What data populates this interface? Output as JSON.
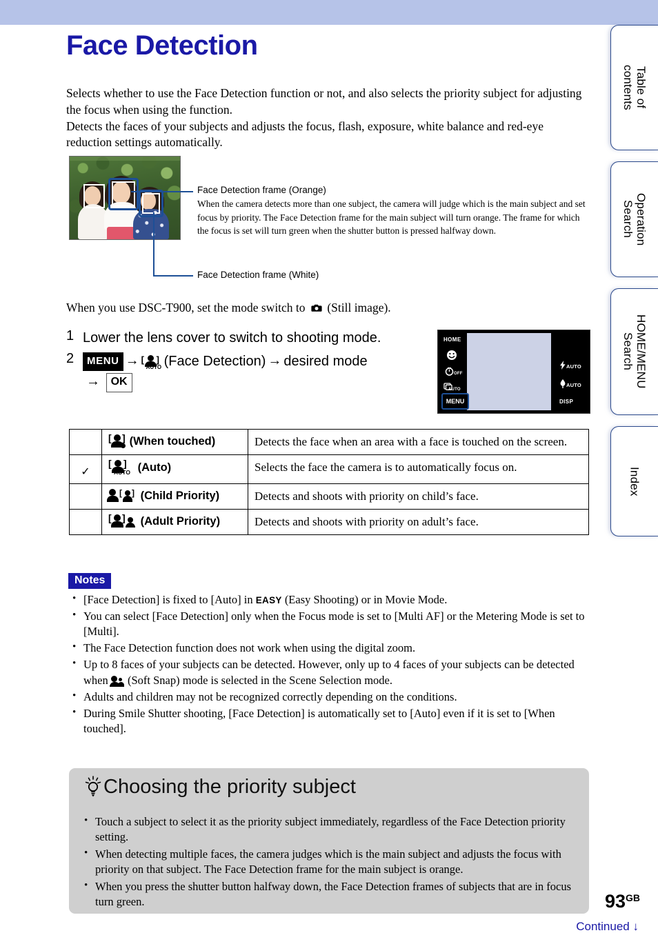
{
  "page": {
    "title": "Face Detection",
    "page_number": "93",
    "page_number_suffix": "GB",
    "continued": "Continued",
    "continued_arrow": "↓"
  },
  "sidebar": {
    "tabs": [
      {
        "label": "Table of\ncontents",
        "name": "table-of-contents"
      },
      {
        "label": "Operation\nSearch",
        "name": "operation-search"
      },
      {
        "label": "HOME/MENU\nSearch",
        "name": "home-menu-search"
      },
      {
        "label": "Index",
        "name": "index"
      }
    ]
  },
  "intro": {
    "para1": "Selects whether to use the Face Detection function or not, and also selects the priority subject for adjusting the focus when using the function.",
    "para2": "Detects the faces of your subjects and adjusts the focus, flash, exposure, white balance and red-eye reduction settings automatically."
  },
  "figure": {
    "callout_orange_title": "Face Detection frame (Orange)",
    "callout_orange_body": "When the camera detects more than one subject, the camera will judge which is the main subject and set focus by priority. The Face Detection frame for the main subject will turn orange. The frame for which the focus is set will turn green when the shutter button is pressed halfway down.",
    "callout_white_title": "Face Detection frame (White)"
  },
  "mode_switch": {
    "text_before": "When you use DSC-T900, set the mode switch to",
    "icon": "still-image-camera-icon",
    "text_after": "(Still image)."
  },
  "steps": [
    {
      "num": "1",
      "text": "Lower the lens cover to switch to shooting mode."
    },
    {
      "num": "2",
      "menu_key": "MENU",
      "arrow": "→",
      "face_detection_label": "(Face Detection)",
      "desired_mode": "desired mode",
      "ok_key": "OK"
    }
  ],
  "lcd": {
    "home": "HOME",
    "smile": "smile-shutter-icon",
    "selftimer": "OFF",
    "burst": "AUTO",
    "menu": "MENU",
    "flash": "AUTO",
    "macro": "AUTO",
    "disp": "DISP"
  },
  "table": {
    "rows": [
      {
        "checked": false,
        "icon": "face-detection-when-touched-icon",
        "name": "(When touched)",
        "desc": "Detects the face when an area with a face is touched on the screen."
      },
      {
        "checked": true,
        "check_glyph": "✓",
        "icon": "face-detection-auto-icon",
        "name": "(Auto)",
        "desc": "Selects the face the camera is to automatically focus on."
      },
      {
        "checked": false,
        "icon": "face-detection-child-priority-icon",
        "name": "(Child Priority)",
        "desc": "Detects and shoots with priority on child’s face."
      },
      {
        "checked": false,
        "icon": "face-detection-adult-priority-icon",
        "name": "(Adult Priority)",
        "desc": "Detects and shoots with priority on adult’s face."
      }
    ]
  },
  "notes": {
    "heading": "Notes",
    "items": [
      "[Face Detection] is fixed to [Auto] in EASY (Easy Shooting) or in Movie Mode.",
      "You can select [Face Detection] only when the Focus mode is set to [Multi AF] or the Metering Mode is set to [Multi].",
      "The Face Detection function does not work when using the digital zoom.",
      "Up to 8 faces of your subjects can be detected. However, only up to 4 faces of your subjects can be detected when (Soft Snap) mode is selected in the Scene Selection mode.",
      "Adults and children may not be recognized correctly depending on the conditions.",
      "During Smile Shutter shooting, [Face Detection] is automatically set to [Auto] even if it is set to [When touched]."
    ],
    "easy_key": "EASY"
  },
  "tip": {
    "heading": "Choosing the priority subject",
    "items": [
      "Touch a subject to select it as the priority subject immediately, regardless of the Face Detection priority setting.",
      "When detecting multiple faces, the camera judges which is the main subject and adjusts the focus with priority on that subject. The Face Detection frame for the main subject is orange.",
      "When you press the shutter button halfway down, the Face Detection frames of subjects that are in focus turn green."
    ]
  },
  "colors": {
    "title_blue": "#1a19a6",
    "band_lavender": "#b6c3e8",
    "frame_orange_drawn": "#1d4f96",
    "tip_bg": "#cfcfcf"
  }
}
